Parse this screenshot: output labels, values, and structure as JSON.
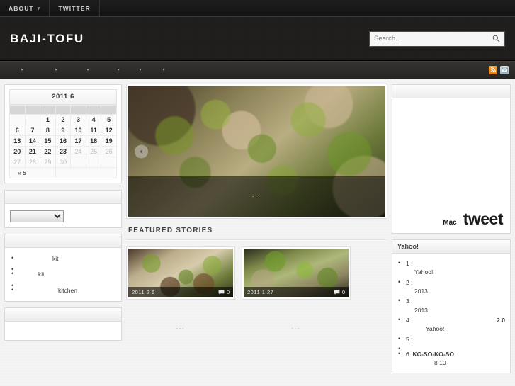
{
  "topbar": {
    "items": [
      {
        "label": "ABOUT",
        "has_caret": true
      },
      {
        "label": "TWITTER",
        "has_caret": false
      }
    ],
    "caret_glyph": "▾"
  },
  "header": {
    "site_title": "BAJI-TOFU",
    "search": {
      "placeholder": "Search...",
      "value": "",
      "icon": "search-icon"
    }
  },
  "nav": {
    "items": [
      {
        "label": "",
        "caret": "▾"
      },
      {
        "label": "",
        "caret": "▾"
      },
      {
        "label": "",
        "caret": "▾"
      },
      {
        "label": "",
        "caret": "▾"
      },
      {
        "label": "",
        "caret": "▾"
      },
      {
        "label": "",
        "caret": "▾"
      }
    ],
    "feeds": [
      {
        "name": "rss-icon",
        "color": "#e8861a"
      },
      {
        "name": "mail-icon",
        "color": "#b6c9d6"
      }
    ]
  },
  "sidebar_left": {
    "calendar": {
      "caption": "2011 6",
      "weekday_headers": [
        "",
        "",
        "",
        "",
        "",
        "",
        ""
      ],
      "weeks": [
        [
          "",
          "",
          "1",
          "2",
          "3",
          "4",
          "5"
        ],
        [
          "6",
          "7",
          "8",
          "9",
          "10",
          "11",
          "12"
        ],
        [
          "13",
          "14",
          "15",
          "16",
          "17",
          "18",
          "19"
        ],
        [
          "20",
          "21",
          "22",
          "23",
          "24",
          "25",
          "26"
        ],
        [
          "27",
          "28",
          "29",
          "30",
          "",
          "",
          ""
        ]
      ],
      "dim_cells": [
        "24",
        "25",
        "26",
        "27",
        "28",
        "29",
        "30"
      ],
      "prev_link": "« 5"
    },
    "select_widget": {
      "title": "",
      "selected": "",
      "options": [
        ""
      ]
    },
    "category_widget": {
      "title": "",
      "items": [
        {
          "label": "kit",
          "indent": "a"
        },
        {
          "label": "",
          "indent": ""
        },
        {
          "label": "kit",
          "indent": "b"
        },
        {
          "label": "",
          "indent": ""
        },
        {
          "label": "kitchen",
          "indent": "c"
        }
      ]
    },
    "extra_widget": {
      "title": ""
    }
  },
  "main": {
    "slider": {
      "caption": "...",
      "prev_label": "prev-arrow-icon"
    },
    "section_title": "FEATURED STORIES",
    "stories": [
      {
        "date": "2011  2  5",
        "comments": "0",
        "excerpt": "..."
      },
      {
        "date": "2011  1  27",
        "comments": "0",
        "excerpt": "..."
      }
    ]
  },
  "sidebar_right": {
    "tagcloud": {
      "title": "",
      "tags": [
        {
          "label": "Mac",
          "size": "small"
        },
        {
          "label": "tweet",
          "size": "large"
        }
      ]
    },
    "news": {
      "title": "Yahoo!",
      "items": [
        {
          "num": "1 :",
          "line2": "Yahoo!",
          "line2_indent": "",
          "bold_tail": ""
        },
        {
          "num": "2 :",
          "line2": "2013",
          "line2_indent": "",
          "bold_tail": ""
        },
        {
          "num": "3 :",
          "line2": "2013",
          "line2_indent": "",
          "bold_tail": ""
        },
        {
          "num": "4 :",
          "line2": "Yahoo!",
          "line2_indent": "ind",
          "bold_tail": "2.0"
        },
        {
          "num": "5 :",
          "line2": "",
          "line2_indent": "",
          "bold_tail": ""
        },
        {
          "num": "6 :",
          "title_bold": "KO-SO-KO-SO",
          "line2": "8 10",
          "line2_indent": "ind2",
          "bold_tail": ""
        }
      ]
    }
  }
}
